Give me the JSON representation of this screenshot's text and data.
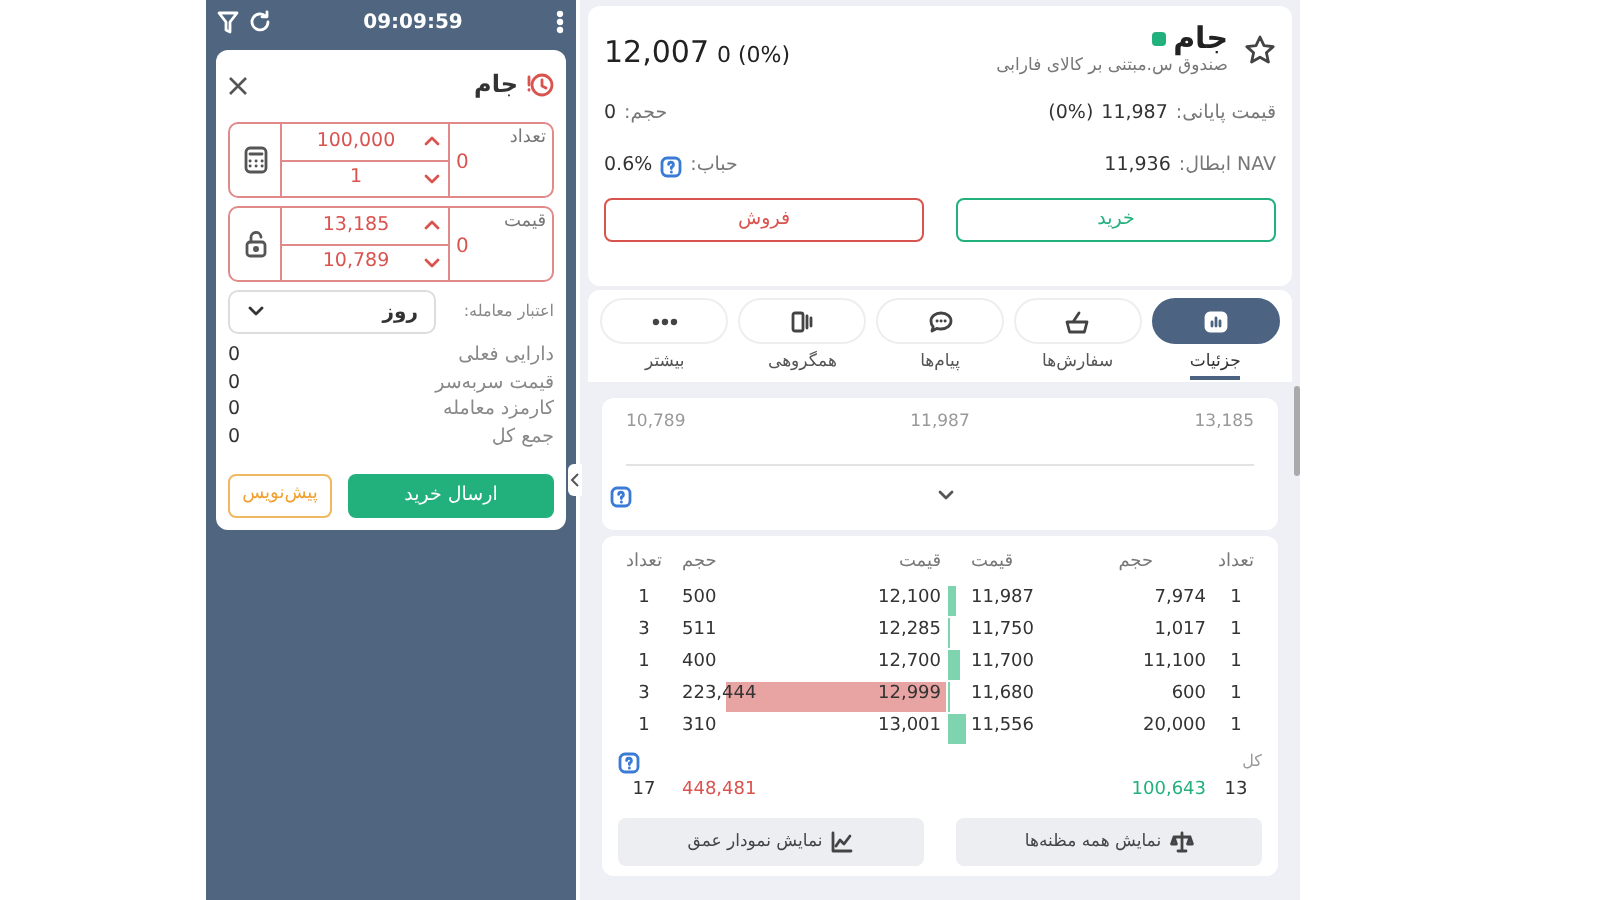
{
  "status_bar": {
    "time": "09:09:59"
  },
  "order_form": {
    "title": "جام",
    "quantity": {
      "label": "تعداد",
      "value": "0",
      "max": "100,000",
      "min": "1"
    },
    "price": {
      "label": "قیمت",
      "value": "0",
      "max": "13,185",
      "min": "10,789"
    },
    "validity": {
      "label": "اعتبار معامله:",
      "value": "روز"
    },
    "summary": [
      {
        "label": "دارایی فعلی",
        "value": "0"
      },
      {
        "label": "قیمت سربه‌سر",
        "value": "0"
      },
      {
        "label": "کارمزد معامله",
        "value": "0"
      },
      {
        "label": "جمع کل",
        "value": "0"
      }
    ],
    "submit": "ارسال خرید",
    "draft": "پیش‌نویس"
  },
  "symbol": {
    "name": "جام",
    "description": "صندوق س.مبتنی بر کالای فارابی",
    "last_price": "12,007",
    "change": "0 (0%)",
    "final_price": {
      "label": "قیمت پایانی:",
      "value": "11,987",
      "change": "(0%)"
    },
    "volume": {
      "label": "حجم:",
      "value": "0"
    },
    "nav": {
      "label": "NAV ابطال:",
      "value": "11,936"
    },
    "bubble": {
      "label": "حباب:",
      "value": "0.6%"
    },
    "buy": "خرید",
    "sell": "فروش"
  },
  "tabs": [
    {
      "label": "جزئیات",
      "selected": true
    },
    {
      "label": "سفارش‌ها",
      "selected": false
    },
    {
      "label": "پیام‌ها",
      "selected": false
    },
    {
      "label": "همگروهی",
      "selected": false
    },
    {
      "label": "بیشتر",
      "selected": false
    }
  ],
  "price_range": {
    "low": "10,789",
    "mid": "11,987",
    "high": "13,185"
  },
  "order_book": {
    "columns": [
      "تعداد",
      "حجم",
      "قیمت",
      "قیمت",
      "حجم",
      "تعداد"
    ],
    "rows": [
      {
        "buy_count": "1",
        "buy_volume": "7,974",
        "buy_price": "11,987",
        "sell_price": "12,100",
        "sell_volume": "500",
        "sell_count": "1"
      },
      {
        "buy_count": "1",
        "buy_volume": "1,017",
        "buy_price": "11,750",
        "sell_price": "12,285",
        "sell_volume": "511",
        "sell_count": "3"
      },
      {
        "buy_count": "1",
        "buy_volume": "11,100",
        "buy_price": "11,700",
        "sell_price": "12,700",
        "sell_volume": "400",
        "sell_count": "1"
      },
      {
        "buy_count": "1",
        "buy_volume": "600",
        "buy_price": "11,680",
        "sell_price": "12,999",
        "sell_volume": "223,444",
        "sell_count": "3"
      },
      {
        "buy_count": "1",
        "buy_volume": "20,000",
        "buy_price": "11,556",
        "sell_price": "13,001",
        "sell_volume": "310",
        "sell_count": "1"
      }
    ],
    "total_label": "کل",
    "totals": {
      "buy_count": "13",
      "buy_volume": "100,643",
      "sell_volume": "448,481",
      "sell_count": "17"
    },
    "buttons": [
      "نمایش همه مظنه‌ها",
      "نمایش نمودار عمق"
    ]
  }
}
